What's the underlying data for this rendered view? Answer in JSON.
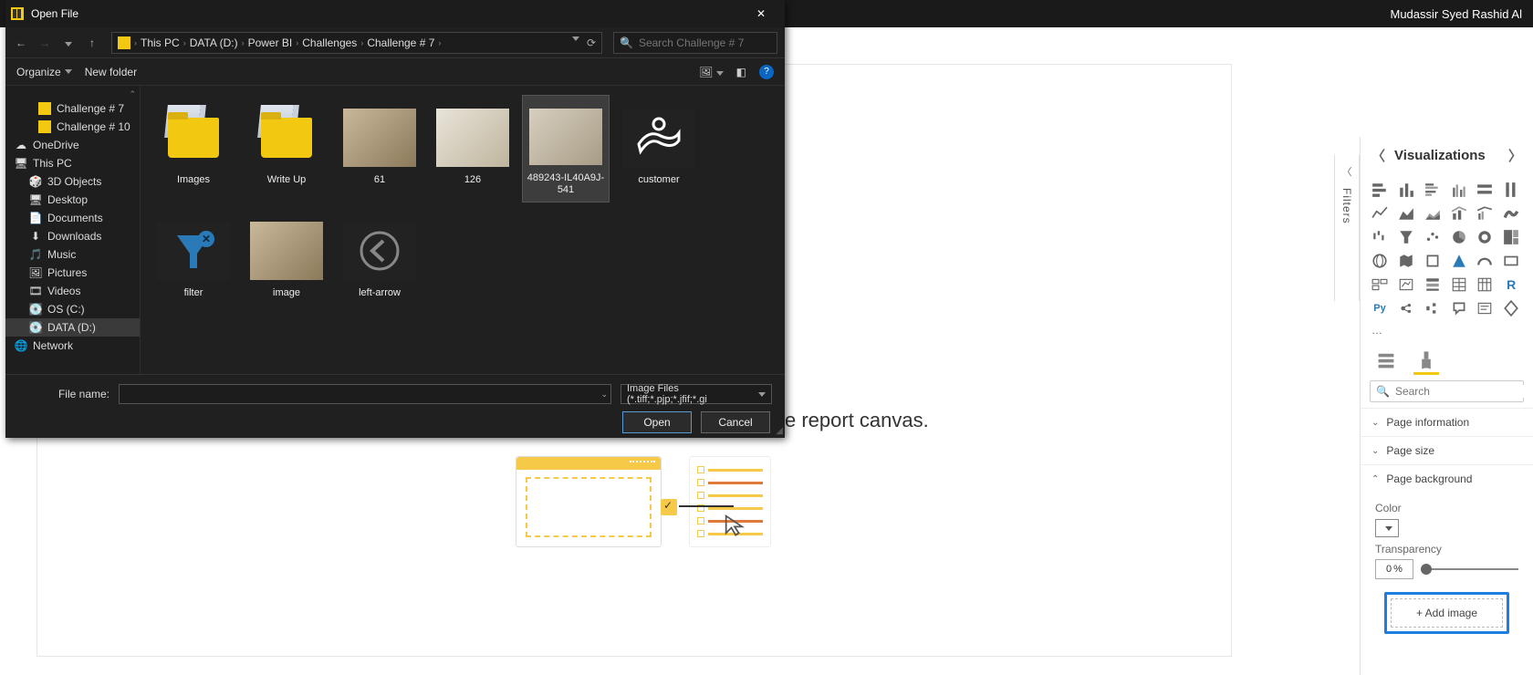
{
  "pbi": {
    "user_name": "Mudassir Syed Rashid Al"
  },
  "canvas": {
    "hint_tail": "e report canvas."
  },
  "filters": {
    "label": "Filters"
  },
  "viz": {
    "title": "Visualizations",
    "more": "…",
    "search_placeholder": "Search",
    "sections": {
      "page_info": "Page information",
      "page_size": "Page size",
      "page_bg": "Page background"
    },
    "bg": {
      "color_label": "Color",
      "transparency_label": "Transparency",
      "transparency_value": "0",
      "transparency_unit": "%",
      "add_image": "+ Add image"
    }
  },
  "dialog": {
    "title": "Open File",
    "organize": "Organize",
    "new_folder": "New folder",
    "search_placeholder": "Search Challenge # 7",
    "breadcrumb": [
      "This PC",
      "DATA (D:)",
      "Power BI",
      "Challenges",
      "Challenge # 7"
    ],
    "tree": [
      {
        "label": "Challenge # 7",
        "icon": "folder",
        "level": 3
      },
      {
        "label": "Challenge # 10",
        "icon": "folder",
        "level": 3
      },
      {
        "label": "OneDrive",
        "icon": "cloud",
        "level": 1
      },
      {
        "label": "This PC",
        "icon": "pc",
        "level": 1
      },
      {
        "label": "3D Objects",
        "icon": "obj",
        "level": 2
      },
      {
        "label": "Desktop",
        "icon": "desk",
        "level": 2
      },
      {
        "label": "Documents",
        "icon": "doc",
        "level": 2
      },
      {
        "label": "Downloads",
        "icon": "dl",
        "level": 2
      },
      {
        "label": "Music",
        "icon": "music",
        "level": 2
      },
      {
        "label": "Pictures",
        "icon": "pic",
        "level": 2
      },
      {
        "label": "Videos",
        "icon": "vid",
        "level": 2
      },
      {
        "label": "OS (C:)",
        "icon": "drive",
        "level": 2
      },
      {
        "label": "DATA (D:)",
        "icon": "drive",
        "level": 2,
        "selected": true
      },
      {
        "label": "Network",
        "icon": "net",
        "level": 1
      }
    ],
    "files": [
      {
        "name": "Images",
        "type": "folder"
      },
      {
        "name": "Write Up",
        "type": "folder"
      },
      {
        "name": "61",
        "type": "photo"
      },
      {
        "name": "126",
        "type": "photo2"
      },
      {
        "name": "489243-IL40A9J-541",
        "type": "photo3",
        "selected": true
      },
      {
        "name": "customer",
        "type": "svg_customer"
      },
      {
        "name": "filter",
        "type": "svg_filter"
      },
      {
        "name": "image",
        "type": "photo"
      },
      {
        "name": "left-arrow",
        "type": "svg_left"
      }
    ],
    "filename_label": "File name:",
    "file_name_value": "",
    "filter_label": "Image Files (*.tiff;*.pjp;*.jfif;*.gi",
    "open": "Open",
    "cancel": "Cancel"
  }
}
